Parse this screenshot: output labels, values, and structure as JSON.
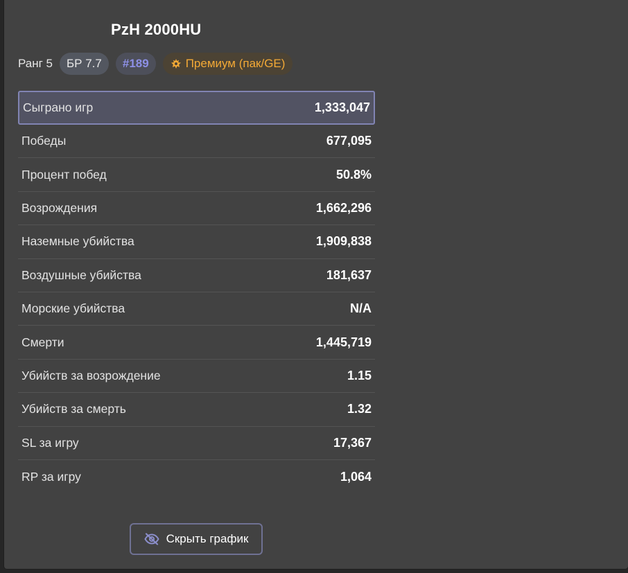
{
  "vehicle": {
    "name": "PzH 2000HU"
  },
  "badges": {
    "rank": "Ранг 5",
    "br": "БР 7.7",
    "position": "#189",
    "premium": "Премиум (пак/GE)",
    "premium_icon": "premium-crest-icon",
    "colors": {
      "position": "#8d90e6",
      "premium": "#f3a936"
    }
  },
  "stats": [
    {
      "label": "Сыграно игр",
      "value": "1,333,047",
      "active": true
    },
    {
      "label": "Победы",
      "value": "677,095"
    },
    {
      "label": "Процент побед",
      "value": "50.8%"
    },
    {
      "label": "Возрождения",
      "value": "1,662,296"
    },
    {
      "label": "Наземные убийства",
      "value": "1,909,838"
    },
    {
      "label": "Воздушные убийства",
      "value": "181,637"
    },
    {
      "label": "Морские убийства",
      "value": "N/A"
    },
    {
      "label": "Смерти",
      "value": "1,445,719"
    },
    {
      "label": "Убийств за возрождение",
      "value": "1.15"
    },
    {
      "label": "Убийств за смерть",
      "value": "1.32"
    },
    {
      "label": "SL за игру",
      "value": "17,367"
    },
    {
      "label": "RP за игру",
      "value": "1,064"
    }
  ],
  "actions": {
    "hide_chart_label": "Скрыть график",
    "hide_chart_icon": "eye-off-icon"
  }
}
